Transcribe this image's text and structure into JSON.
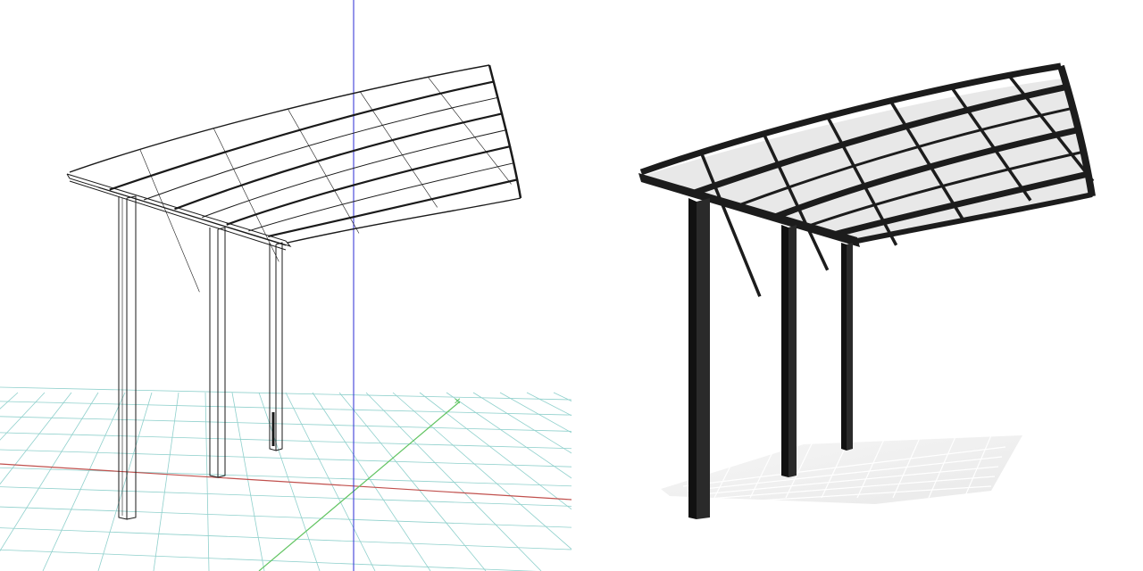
{
  "views": [
    {
      "name": "wireframe-view",
      "style": "wireframe"
    },
    {
      "name": "rendered-view",
      "style": "shaded"
    }
  ],
  "colors": {
    "background": "#ffffff",
    "grid": "#8fd0cc",
    "x_axis": "#c0504d",
    "y_axis": "#62c462",
    "z_axis": "#2b2bd6",
    "wire": "#1a1a1a",
    "frame": "#1c1c1c",
    "roof_panel": "#e6e6e6",
    "floor_reflection": "#eeeeee"
  },
  "icons": [
    "cursor-mark"
  ]
}
